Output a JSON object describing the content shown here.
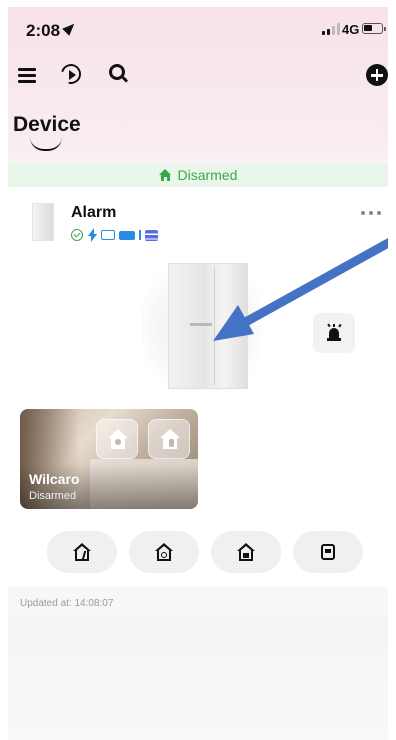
{
  "status_bar": {
    "time": "2:08",
    "network": "4G"
  },
  "toolbar": {
    "menu_icon": "menu-icon",
    "playback_icon": "playback-icon",
    "search_icon": "search-icon",
    "add_icon": "add-icon"
  },
  "page": {
    "title": "Device"
  },
  "system_status": {
    "label": "Disarmed",
    "color": "#3aa84a"
  },
  "device": {
    "name": "Alarm",
    "status_icons": [
      "online-check-icon",
      "power-icon",
      "network-icon",
      "battery-icon",
      "storage-icon"
    ],
    "siren_icon": "siren-icon"
  },
  "area": {
    "name": "Wilcaro",
    "status": "Disarmed",
    "actions": [
      "stay-arm-icon",
      "away-arm-icon"
    ]
  },
  "modes": [
    {
      "icon": "away-arm-icon"
    },
    {
      "icon": "stay-arm-icon"
    },
    {
      "icon": "disarm-icon"
    },
    {
      "icon": "clear-alarm-icon"
    }
  ],
  "footer": {
    "updated": "Updated at: 14:08:07"
  },
  "colors": {
    "accent_blue": "#2a8ce0",
    "annotation_arrow": "#4472c4"
  }
}
